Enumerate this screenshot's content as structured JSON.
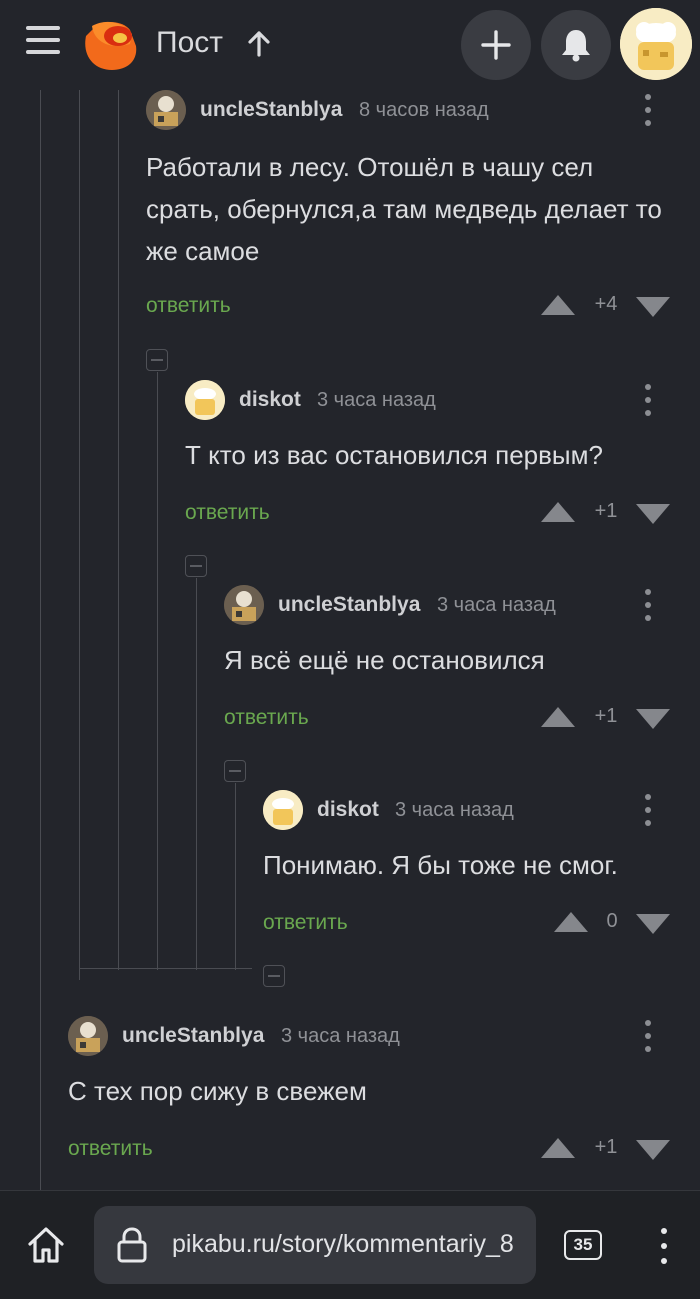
{
  "header": {
    "title": "Пост",
    "icons": [
      "menu-icon",
      "pikabu-logo",
      "up-arrow-icon",
      "plus-icon",
      "bell-icon",
      "user-avatar"
    ]
  },
  "comments": [
    {
      "author": "uncleStanblya",
      "time": "8 часов назад",
      "text": "Работали в лесу. Отошёл в чашу сел срать, обернулся,а там медведь делает то же самое",
      "reply": "ответить",
      "rating": "+4"
    },
    {
      "author": "diskot",
      "time": "3 часа назад",
      "text": "Т кто из вас остановился первым?",
      "reply": "ответить",
      "rating": "+1"
    },
    {
      "author": "uncleStanblya",
      "time": "3 часа назад",
      "text": "Я всё ещё не остановился",
      "reply": "ответить",
      "rating": "+1"
    },
    {
      "author": "diskot",
      "time": "3 часа назад",
      "text": "Понимаю. Я бы тоже не смог.",
      "reply": "ответить",
      "rating": "0"
    },
    {
      "author": "uncleStanblya",
      "time": "3 часа назад",
      "text": "С тех пор сижу в свежем",
      "reply": "ответить",
      "rating": "+1"
    }
  ],
  "browser": {
    "url": "pikabu.ru/story/kommentariy_8",
    "tabs_count": "35"
  },
  "colors": {
    "background": "#23252b",
    "reply_link": "#6aa84f",
    "muted": "#8f9196"
  }
}
